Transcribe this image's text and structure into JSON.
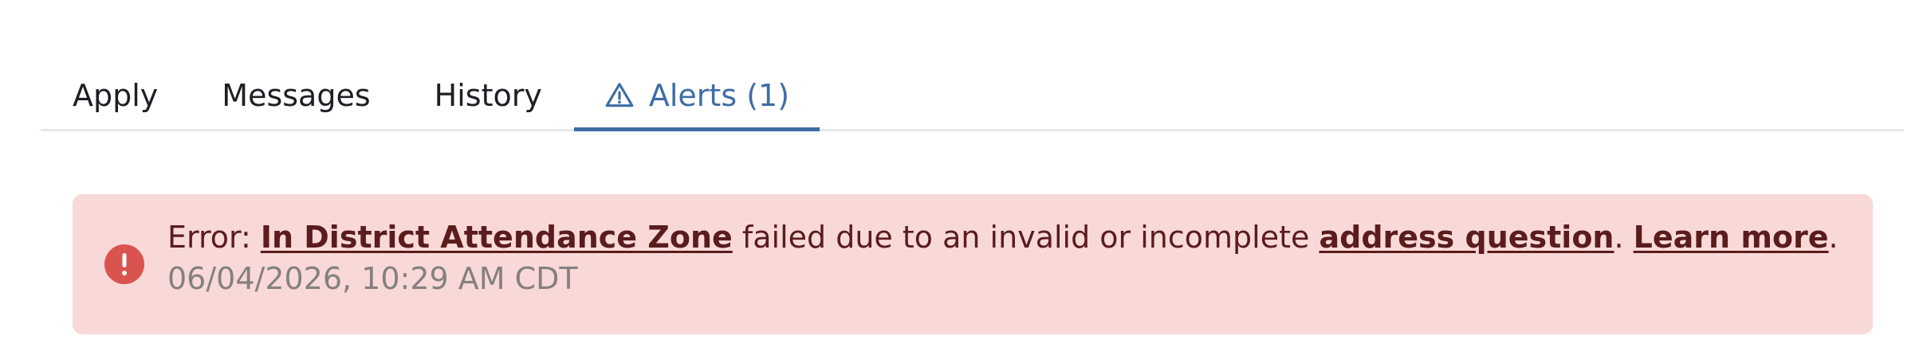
{
  "tabs": {
    "apply": "Apply",
    "messages": "Messages",
    "history": "History",
    "alerts": "Alerts (1)"
  },
  "alert": {
    "prefix": "Error: ",
    "link_zone": "In District Attendance Zone",
    "middle": " failed due to an invalid or incomplete ",
    "link_address": "address question",
    "sep": ". ",
    "link_learn": "Learn more",
    "suffix": ".",
    "timestamp": "06/04/2026, 10:29 AM CDT"
  },
  "colors": {
    "accent": "#3e6da5",
    "alert_bg": "#f8d9d8",
    "alert_icon": "#d9534f",
    "alert_text": "#5a1c1c"
  }
}
